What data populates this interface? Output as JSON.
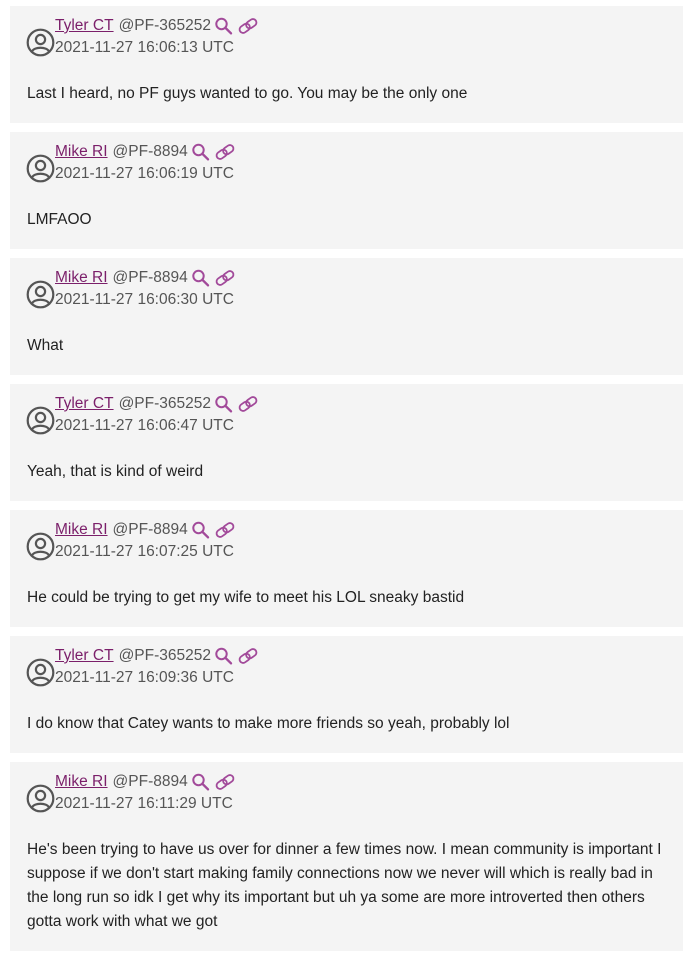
{
  "posts": [
    {
      "author": "Tyler CT",
      "handle": "@PF-365252",
      "timestamp": "2021-11-27 16:06:13 UTC",
      "text": "Last I heard, no PF guys wanted to go. You may be the only one"
    },
    {
      "author": "Mike RI",
      "handle": "@PF-8894",
      "timestamp": "2021-11-27 16:06:19 UTC",
      "text": "LMFAOO"
    },
    {
      "author": "Mike RI",
      "handle": "@PF-8894",
      "timestamp": "2021-11-27 16:06:30 UTC",
      "text": "What"
    },
    {
      "author": "Tyler CT",
      "handle": "@PF-365252",
      "timestamp": "2021-11-27 16:06:47 UTC",
      "text": "Yeah, that is kind of weird"
    },
    {
      "author": "Mike RI",
      "handle": "@PF-8894",
      "timestamp": "2021-11-27 16:07:25 UTC",
      "text": "He could be trying to get my wife to meet his LOL sneaky bastid"
    },
    {
      "author": "Tyler CT",
      "handle": "@PF-365252",
      "timestamp": "2021-11-27 16:09:36 UTC",
      "text": "I do know that Catey wants to make more friends so yeah, probably lol"
    },
    {
      "author": "Mike RI",
      "handle": "@PF-8894",
      "timestamp": "2021-11-27 16:11:29 UTC",
      "text": "He's been trying to have us over for dinner a few times now. I mean community is important I suppose if we don't start making family connections now we never will which is really bad in the long run so idk I get why its important but uh ya some are more introverted then others gotta work with what we got"
    }
  ],
  "icons": {
    "avatar": "user-circle-icon",
    "search": "search-icon",
    "link": "link-icon"
  },
  "colors": {
    "author_link": "#7b1f6a",
    "icon_accent": "#a24a9a",
    "card_bg": "#f4f4f4",
    "muted_text": "#555555"
  }
}
